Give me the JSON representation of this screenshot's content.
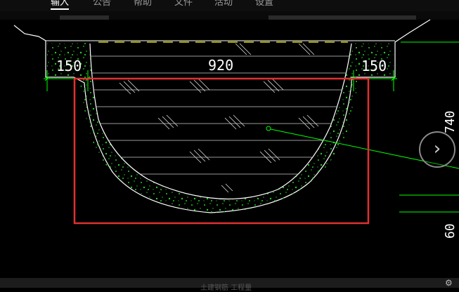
{
  "tabs": [
    "输入",
    "公告",
    "帮助",
    "文件",
    "活动",
    "设置"
  ],
  "active_tab": 0,
  "dimensions": {
    "left_flange": "150",
    "channel_width": "920",
    "right_flange": "150",
    "height_right": "740",
    "bottom_right": "60"
  },
  "icons": {
    "next": "chevron-right-icon",
    "corner": "gear-icon"
  },
  "colors": {
    "background": "#000000",
    "outline": "#ffffff",
    "dimension_line": "#00ff00",
    "highlight_box": "#e03030",
    "top_dash": "#ffff00"
  },
  "bottom_text": "土建钢筋  工程量"
}
